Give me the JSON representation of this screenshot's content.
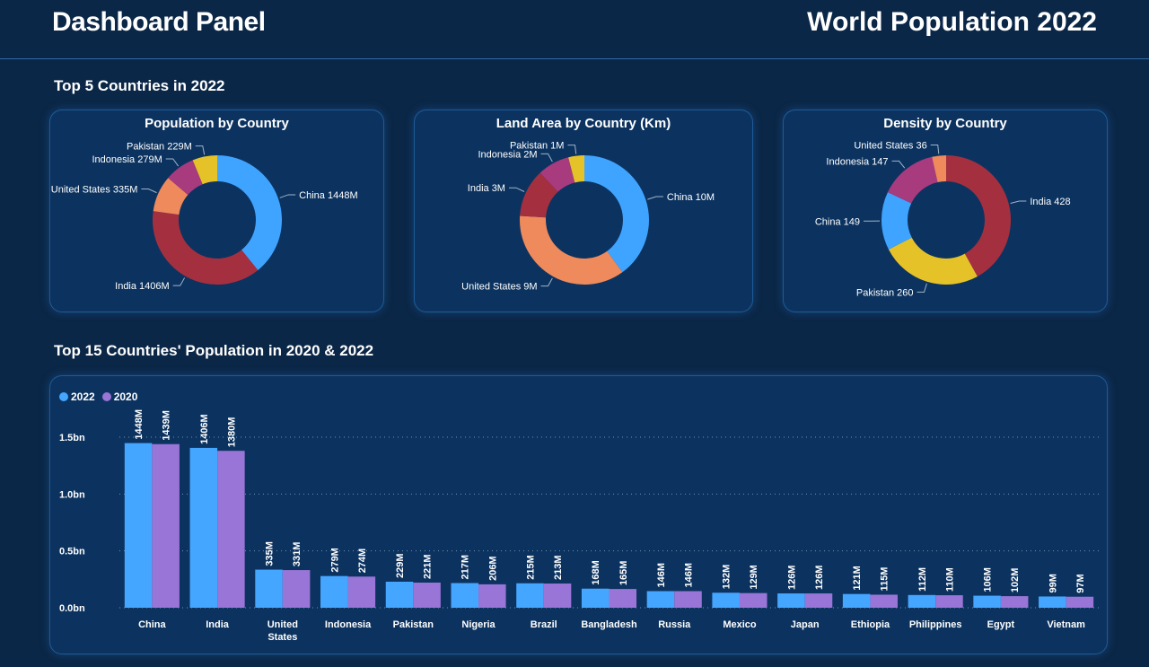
{
  "header": {
    "title": "Dashboard Panel",
    "subtitle": "World Population 2022"
  },
  "sections": {
    "top5": "Top 5 Countries in 2022",
    "top15": "Top 15 Countries' Population in 2020 & 2022"
  },
  "chart_data": [
    {
      "type": "pie",
      "title": "Population by Country",
      "slices": [
        {
          "label": "China",
          "value": 1448,
          "display": "China 1448M",
          "color": "#3fa4ff"
        },
        {
          "label": "India",
          "value": 1406,
          "display": "India 1406M",
          "color": "#a4303f"
        },
        {
          "label": "United States",
          "value": 335,
          "display": "United States 335M",
          "color": "#ee8a5c"
        },
        {
          "label": "Indonesia",
          "value": 279,
          "display": "Indonesia 279M",
          "color": "#a83a7e"
        },
        {
          "label": "Pakistan",
          "value": 229,
          "display": "Pakistan 229M",
          "color": "#e6c229"
        }
      ]
    },
    {
      "type": "pie",
      "title": "Land Area by Country (Km)",
      "slices": [
        {
          "label": "China",
          "value": 10,
          "display": "China 10M",
          "color": "#3fa4ff"
        },
        {
          "label": "United States",
          "value": 9,
          "display": "United States 9M",
          "color": "#ee8a5c"
        },
        {
          "label": "India",
          "value": 3,
          "display": "India 3M",
          "color": "#a4303f"
        },
        {
          "label": "Indonesia",
          "value": 2,
          "display": "Indonesia 2M",
          "color": "#a83a7e"
        },
        {
          "label": "Pakistan",
          "value": 1,
          "display": "Pakistan 1M",
          "color": "#e6c229"
        }
      ]
    },
    {
      "type": "pie",
      "title": "Density by Country",
      "slices": [
        {
          "label": "India",
          "value": 428,
          "display": "India 428",
          "color": "#a4303f"
        },
        {
          "label": "Pakistan",
          "value": 260,
          "display": "Pakistan 260",
          "color": "#e6c229"
        },
        {
          "label": "China",
          "value": 149,
          "display": "China 149",
          "color": "#3fa4ff"
        },
        {
          "label": "Indonesia",
          "value": 147,
          "display": "Indonesia 147",
          "color": "#a83a7e"
        },
        {
          "label": "United States",
          "value": 36,
          "display": "United States 36",
          "color": "#ee8a5c"
        }
      ]
    },
    {
      "type": "bar",
      "categories": [
        "China",
        "India",
        "United States",
        "Indonesia",
        "Pakistan",
        "Nigeria",
        "Brazil",
        "Bangladesh",
        "Russia",
        "Mexico",
        "Japan",
        "Ethiopia",
        "Philippines",
        "Egypt",
        "Vietnam"
      ],
      "series": [
        {
          "name": "2022",
          "color": "#45a6ff",
          "values": [
            1448,
            1406,
            335,
            279,
            229,
            217,
            215,
            168,
            146,
            132,
            126,
            121,
            112,
            106,
            99
          ]
        },
        {
          "name": "2020",
          "color": "#9875d6",
          "values": [
            1439,
            1380,
            331,
            274,
            221,
            206,
            213,
            165,
            146,
            129,
            126,
            115,
            110,
            102,
            97
          ]
        }
      ],
      "value_suffix": "M",
      "yticks": [
        "0.0bn",
        "0.5bn",
        "1.0bn",
        "1.5bn"
      ],
      "ylim": [
        0,
        1500
      ],
      "legend": "top-left",
      "grid": true
    }
  ]
}
